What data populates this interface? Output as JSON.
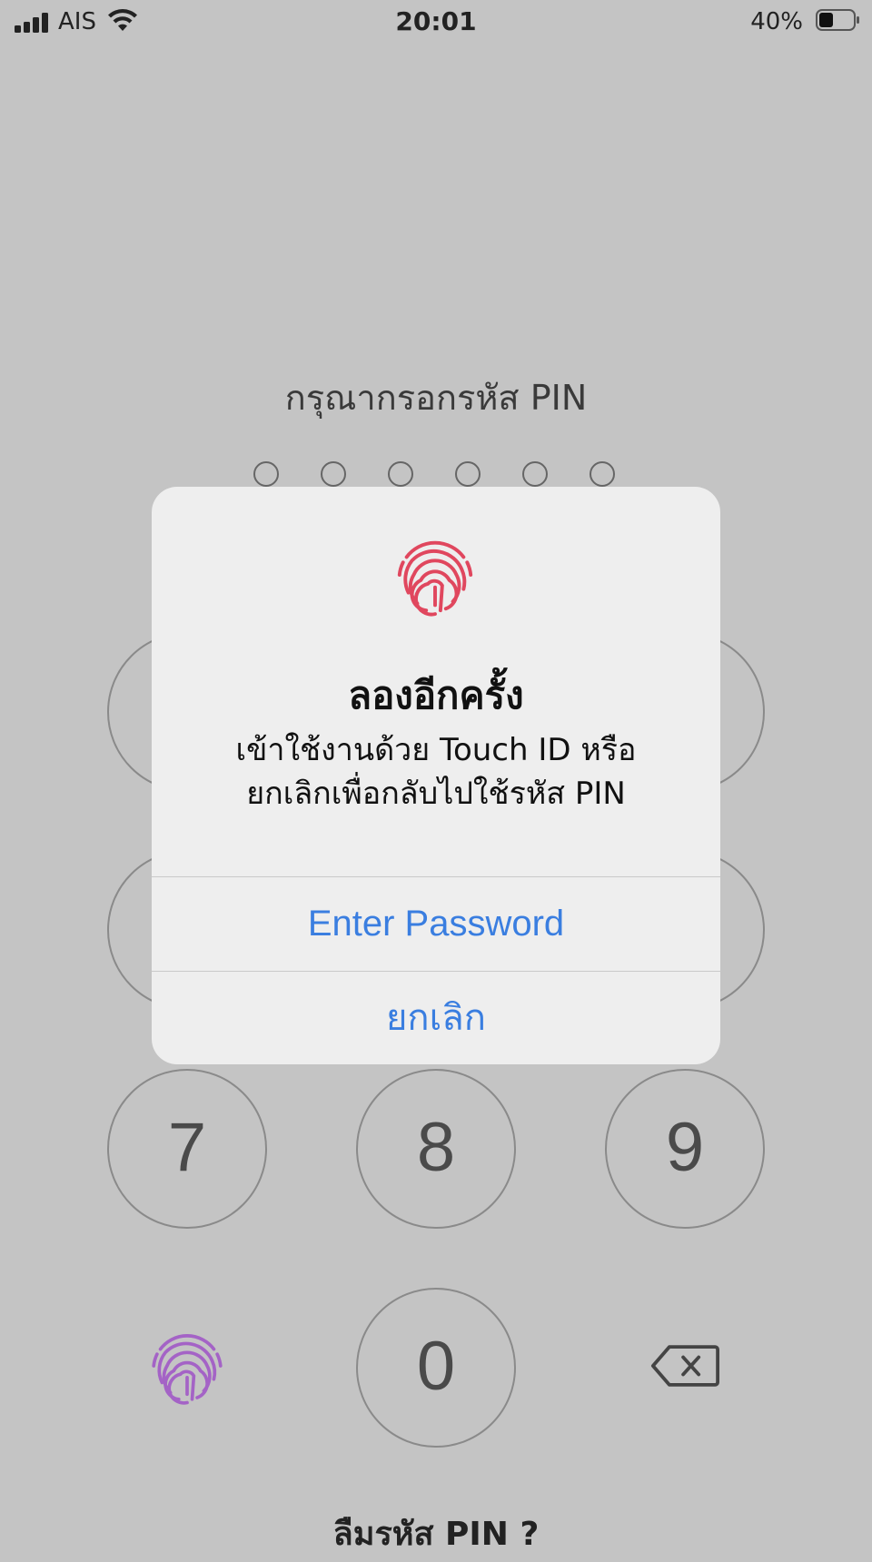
{
  "status_bar": {
    "carrier": "AIS",
    "time": "20:01",
    "battery_percent": "40%"
  },
  "pin_screen": {
    "title": "กรุณากรอกรหัส PIN",
    "digits_entered": 0,
    "digits_total": 6,
    "keys": {
      "k7": "7",
      "k8": "8",
      "k9": "9",
      "k0": "0"
    },
    "forgot_label": "ลืมรหัส PIN ?"
  },
  "alert": {
    "icon": "fingerprint-icon",
    "icon_color": "#e0475e",
    "title": "ลองอีกครั้ง",
    "message_line1": "เข้าใช้งานด้วย Touch ID หรือ",
    "message_line2": "ยกเลิกเพื่อกลับไปใช้รหัส PIN",
    "primary_button": "Enter Password",
    "cancel_button": "ยกเลิก",
    "button_color": "#3a7ee0"
  },
  "keypad_icons": {
    "touch_id": "fingerprint-icon",
    "touch_id_color": "#a463c6",
    "delete": "backspace-icon"
  }
}
